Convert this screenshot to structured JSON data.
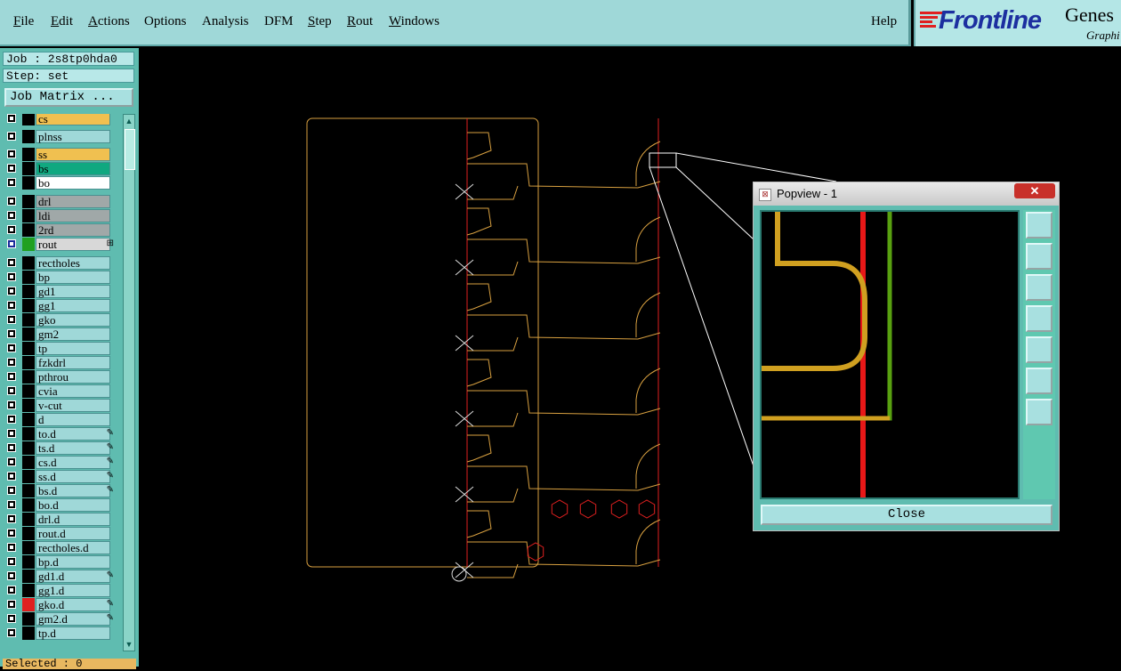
{
  "menu": {
    "items": [
      "File",
      "Edit",
      "Actions",
      "Options",
      "Analysis",
      "DFM",
      "Step",
      "Rout",
      "Windows"
    ],
    "help": "Help"
  },
  "logo": {
    "brand": "Frontline",
    "product": "Genes",
    "subtitle": "Graphi"
  },
  "panel": {
    "job": "Job : 2s8tp0hda0",
    "step": "Step: set",
    "job_matrix": "Job Matrix ...",
    "status": "Selected : 0"
  },
  "layers": [
    {
      "name": "cs",
      "color": "#f0c050",
      "swatch": "#000000"
    },
    {
      "name": "plnss",
      "color": "#9fd8d8",
      "swatch": "#000000"
    },
    {
      "name": "ss",
      "color": "#f0c050",
      "swatch": "#000000"
    },
    {
      "name": "bs",
      "color": "#10a880",
      "swatch": "#000000"
    },
    {
      "name": "bo",
      "color": "#ffffff",
      "swatch": "#000000"
    },
    {
      "name": "drl",
      "color": "#a0a8a8",
      "swatch": "#000000"
    },
    {
      "name": "ldi",
      "color": "#a0a8a8",
      "swatch": "#000000"
    },
    {
      "name": "2rd",
      "color": "#a0a8a8",
      "swatch": "#000000"
    },
    {
      "name": "rout",
      "color": "#d8d8d8",
      "swatch": "#20a020",
      "flag": "⊞"
    },
    {
      "name": "rectholes",
      "color": "#9fd8d8",
      "swatch": "#000000"
    },
    {
      "name": "bp",
      "color": "#9fd8d8",
      "swatch": "#000000"
    },
    {
      "name": "gd1",
      "color": "#9fd8d8",
      "swatch": "#000000"
    },
    {
      "name": "gg1",
      "color": "#9fd8d8",
      "swatch": "#000000"
    },
    {
      "name": "gko",
      "color": "#9fd8d8",
      "swatch": "#000000"
    },
    {
      "name": "gm2",
      "color": "#9fd8d8",
      "swatch": "#000000"
    },
    {
      "name": "tp",
      "color": "#9fd8d8",
      "swatch": "#000000"
    },
    {
      "name": "fzkdrl",
      "color": "#9fd8d8",
      "swatch": "#000000"
    },
    {
      "name": "pthrou",
      "color": "#9fd8d8",
      "swatch": "#000000"
    },
    {
      "name": "cvia",
      "color": "#9fd8d8",
      "swatch": "#000000"
    },
    {
      "name": "v-cut",
      "color": "#9fd8d8",
      "swatch": "#000000"
    },
    {
      "name": "d",
      "color": "#9fd8d8",
      "swatch": "#000000"
    },
    {
      "name": "to.d",
      "color": "#9fd8d8",
      "swatch": "#000000",
      "flag": "✎"
    },
    {
      "name": "ts.d",
      "color": "#9fd8d8",
      "swatch": "#000000",
      "flag": "✎"
    },
    {
      "name": "cs.d",
      "color": "#9fd8d8",
      "swatch": "#000000",
      "flag": "✎"
    },
    {
      "name": "ss.d",
      "color": "#9fd8d8",
      "swatch": "#000000",
      "flag": "✎"
    },
    {
      "name": "bs.d",
      "color": "#9fd8d8",
      "swatch": "#000000",
      "flag": "✎"
    },
    {
      "name": "bo.d",
      "color": "#9fd8d8",
      "swatch": "#000000"
    },
    {
      "name": "drl.d",
      "color": "#9fd8d8",
      "swatch": "#000000"
    },
    {
      "name": "rout.d",
      "color": "#9fd8d8",
      "swatch": "#000000"
    },
    {
      "name": "rectholes.d",
      "color": "#9fd8d8",
      "swatch": "#000000"
    },
    {
      "name": "bp.d",
      "color": "#9fd8d8",
      "swatch": "#000000"
    },
    {
      "name": "gd1.d",
      "color": "#9fd8d8",
      "swatch": "#000000",
      "flag": "✎"
    },
    {
      "name": "gg1.d",
      "color": "#9fd8d8",
      "swatch": "#000000"
    },
    {
      "name": "gko.d",
      "color": "#9fd8d8",
      "swatch": "#e02020",
      "flag": "✎"
    },
    {
      "name": "gm2.d",
      "color": "#9fd8d8",
      "swatch": "#000000",
      "flag": "✎"
    },
    {
      "name": "tp.d",
      "color": "#9fd8d8",
      "swatch": "#000000"
    }
  ],
  "popview": {
    "title": "Popview - 1",
    "close": "Close",
    "close_x": "✕"
  },
  "colors": {
    "outline": "#d8a040",
    "rout_red": "#e02020",
    "green": "#50a010",
    "panel": "#5fbcb0"
  }
}
